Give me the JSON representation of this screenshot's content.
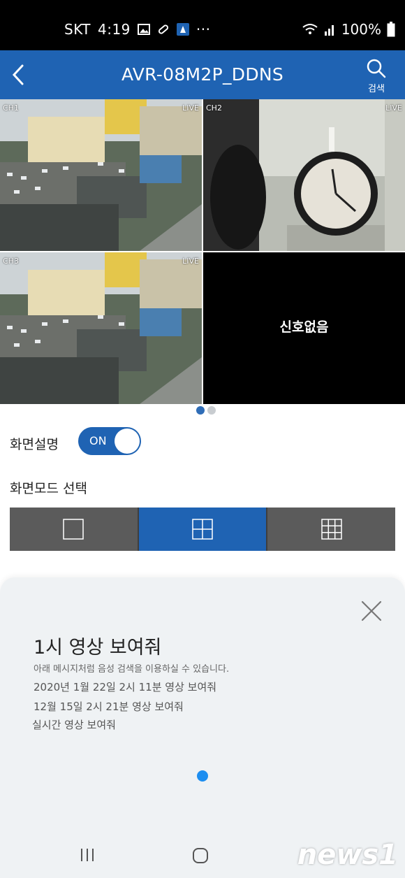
{
  "status_bar": {
    "carrier": "SKT",
    "time": "4:19",
    "battery": "100%"
  },
  "app_bar": {
    "title": "AVR-08M2P_DDNS",
    "search_label": "검색"
  },
  "video": {
    "cells": [
      {
        "channel": "CH1",
        "live": "LIVE"
      },
      {
        "channel": "CH2",
        "live": "LIVE"
      },
      {
        "channel": "CH3",
        "live": "LIVE"
      },
      {
        "no_signal": "신호없음"
      }
    ],
    "page_count": 2,
    "active_page": 1
  },
  "settings": {
    "screen_desc_label": "화면설명",
    "toggle_label": "ON",
    "mode_label": "화면모드 선택",
    "modes": [
      "1-split",
      "4-split",
      "9-split"
    ],
    "active_mode": "4-split"
  },
  "sheet": {
    "title": "1시 영상 보여줘",
    "hint": "아래 메시지처럼 음성 검색을 이용하실 수 있습니다.",
    "examples": [
      "2020년 1월 22일 2시 11분 영상 보여줘",
      "12월 15일 2시 21분 영상 보여줘",
      "실시간 영상 보여줘"
    ]
  },
  "watermark": "news1",
  "colors": {
    "primary": "#1f63b3",
    "mode_inactive": "#5b5b5b",
    "sheet_bg": "#eff2f4",
    "dot_blue": "#1d8ef0"
  }
}
